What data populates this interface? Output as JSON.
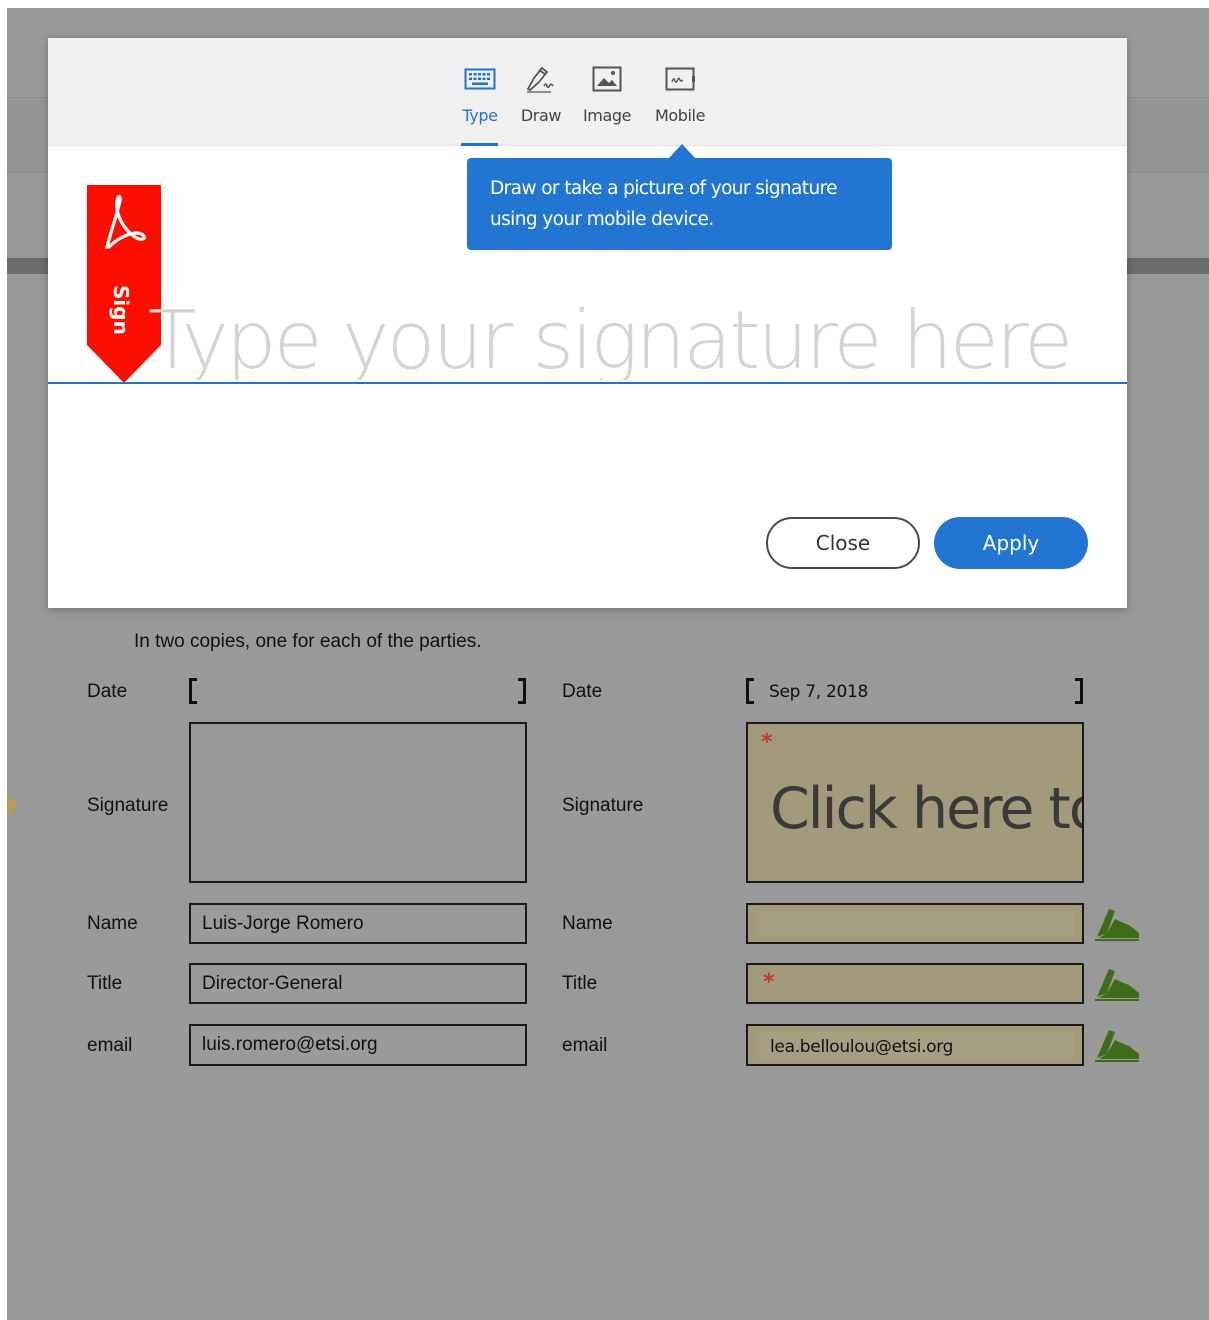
{
  "modal": {
    "tabs": [
      {
        "label": "Type",
        "icon": "keyboard-icon",
        "active": true
      },
      {
        "label": "Draw",
        "icon": "pen-draw-icon",
        "active": false
      },
      {
        "label": "Image",
        "icon": "image-icon",
        "active": false
      },
      {
        "label": "Mobile",
        "icon": "mobile-signature-icon",
        "active": false
      }
    ],
    "tooltip": {
      "line1": "Draw or take a picture of your signature",
      "line2": "using your mobile device."
    },
    "sign_tag": {
      "label": "Sign",
      "icon": "adobe-acrobat-icon",
      "color": "#fa0f00"
    },
    "signature_placeholder": "Type your signature here",
    "close_label": "Close",
    "apply_label": "Apply",
    "accent_color": "#1f74cd"
  },
  "document": {
    "intro": "In two copies, one for each of the parties.",
    "left": {
      "date_label": "Date",
      "date_value": "",
      "signature_label": "Signature",
      "name_label": "Name",
      "name_value": "Luis-Jorge Romero",
      "title_label": "Title",
      "title_value": "Director-General",
      "email_label": "email",
      "email_value": "luis.romero@etsi.org"
    },
    "right": {
      "date_label": "Date",
      "date_value": "Sep 7, 2018",
      "signature_label": "Signature",
      "signature_prompt": "Click here to",
      "name_label": "Name",
      "name_value": "",
      "title_label": "Title",
      "title_value": "",
      "email_label": "email",
      "email_value": "lea.belloulou@etsi.org",
      "required_marker": "*",
      "fill_icon": "sign-pen-icon"
    }
  }
}
